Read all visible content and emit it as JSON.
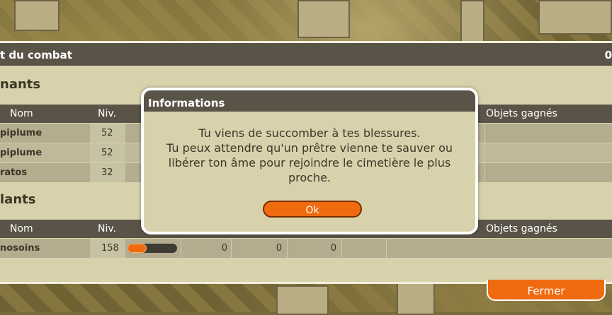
{
  "panel": {
    "title_left": "t du combat",
    "title_right": "0",
    "section_winners": "nants",
    "section_losers": "lants"
  },
  "columns": {
    "name": "Nom",
    "level": "Niv.",
    "objects": "Objets gagnés"
  },
  "winners": [
    {
      "name": "piplume",
      "level": "52"
    },
    {
      "name": "piplume",
      "level": "52"
    },
    {
      "name": "ratos",
      "level": "32"
    }
  ],
  "losers": [
    {
      "name": "nosoins",
      "level": "158",
      "xp_fraction": 0.38,
      "v1": "0",
      "v2": "0",
      "v3": "0"
    }
  ],
  "close_button": "Fermer",
  "dialog": {
    "title": "Informations",
    "line1": "Tu viens de succomber à tes blessures.",
    "line2": "Tu peux attendre qu'un prêtre vienne te sauver ou",
    "line3": "libérer ton âme pour rejoindre le cimetière le plus",
    "line4": "proche.",
    "ok_label": "Ok"
  },
  "colors": {
    "accent": "#f06a10",
    "header": "#5a5347",
    "panel": "#d8d2ac"
  }
}
